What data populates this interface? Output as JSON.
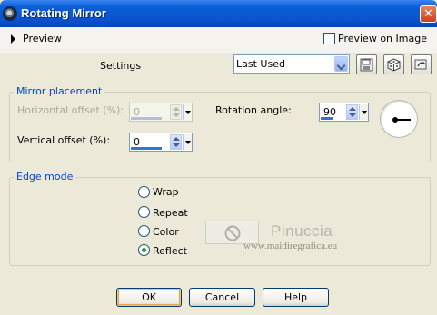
{
  "window": {
    "title": "Rotating Mirror",
    "icon": "camera-lens-icon",
    "close_glyph": "✕"
  },
  "preview": {
    "label": "Preview",
    "preview_on_image_label": "Preview on Image",
    "preview_on_image_checked": false
  },
  "settings": {
    "label": "Settings",
    "preset_value": "Last Used",
    "buttons": [
      {
        "name": "save-preset-icon"
      },
      {
        "name": "randomize-icon"
      },
      {
        "name": "reset-icon"
      }
    ]
  },
  "mirror_placement": {
    "title": "Mirror placement",
    "horizontal_offset": {
      "label": "Horizontal offset (%):",
      "value": "0",
      "enabled": false
    },
    "vertical_offset": {
      "label": "Vertical offset (%):",
      "value": "0",
      "enabled": true
    },
    "rotation_angle": {
      "label": "Rotation angle:",
      "value": "90"
    }
  },
  "edge_mode": {
    "title": "Edge mode",
    "options": [
      "Wrap",
      "Repeat",
      "Color",
      "Reflect"
    ],
    "selected": "Reflect"
  },
  "watermark": {
    "name": "Pinuccia",
    "url": "www.maidiregrafica.eu"
  },
  "buttons": {
    "ok": "OK",
    "cancel": "Cancel",
    "help": "Help"
  },
  "colors": {
    "title_bar": "#0a5fd8",
    "group_title": "#0046d5",
    "dialog_bg": "#ece9d8"
  }
}
